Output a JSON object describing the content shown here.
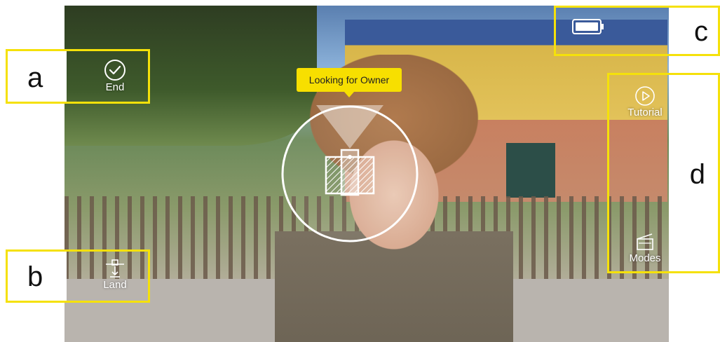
{
  "annotations": {
    "a": "a",
    "b": "b",
    "c": "c",
    "d": "d"
  },
  "controls": {
    "end_label": "End",
    "land_label": "Land",
    "tutorial_label": "Tutorial",
    "modes_label": "Modes"
  },
  "tracking": {
    "status_text": "Looking for Owner"
  },
  "icons": {
    "end": "checkmark-circle-icon",
    "land": "land-drone-icon",
    "tutorial": "play-circle-icon",
    "modes": "clapperboard-icon",
    "battery": "battery-icon",
    "target": "tracking-target-icon"
  },
  "colors": {
    "callout": "#f5e10a",
    "tooltip": "#f7df00"
  }
}
